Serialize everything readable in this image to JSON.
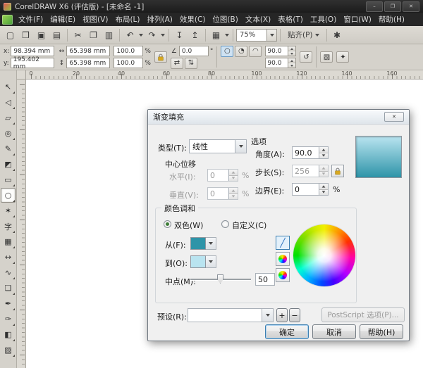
{
  "titlebar": {
    "title": "CorelDRAW X6 (评估版) - [未命名 -1]",
    "minimize_glyph": "–",
    "maximize_glyph": "❐",
    "close_glyph": "✕"
  },
  "menu": {
    "items": [
      "文件(F)",
      "编辑(E)",
      "视图(V)",
      "布局(L)",
      "排列(A)",
      "效果(C)",
      "位图(B)",
      "文本(X)",
      "表格(T)",
      "工具(O)",
      "窗口(W)",
      "帮助(H)"
    ]
  },
  "toolbar": {
    "icons": {
      "new": "▢",
      "open": "❒",
      "save": "▣",
      "print": "▤",
      "cut": "✂",
      "copy": "❐",
      "paste": "▥",
      "undo": "↶",
      "redo": "↷",
      "import": "↧",
      "export": "↥",
      "launcher": "▦",
      "options": "✱"
    },
    "zoom_value": "75%",
    "snap_label": "贴齐(P)"
  },
  "propbar": {
    "x_label": "x:",
    "x_value": "98.394 mm",
    "y_label": "y:",
    "y_value": "195.402 mm",
    "width_icon": "↔",
    "width_value": "65.398 mm",
    "height_icon": "↕",
    "height_value": "65.398 mm",
    "scale_h_value": "100.0",
    "scale_v_value": "100.0",
    "percent": "%",
    "angle_icon": "∠",
    "angle_value": "0.0",
    "degree": "°",
    "mirror_h_icon": "⇄",
    "mirror_v_icon": "⇅",
    "ellipse_icon": "○",
    "pie_icon": "◔",
    "arc_icon": "◠",
    "start_angle_value": "90.0",
    "end_angle_value": "90.0",
    "direction_icon": "↺",
    "wrap_icon": "▧",
    "convert_icon": "✦"
  },
  "ruler": {
    "h_numbers": [
      "0",
      "20",
      "40",
      "60",
      "80",
      "100",
      "120",
      "140",
      "160"
    ]
  },
  "toolbox": {
    "tools": [
      {
        "name": "pick",
        "glyph": "↖"
      },
      {
        "name": "shape",
        "glyph": "◁"
      },
      {
        "name": "crop",
        "glyph": "▱"
      },
      {
        "name": "zoom",
        "glyph": "◎"
      },
      {
        "name": "freehand",
        "glyph": "✎"
      },
      {
        "name": "smart-fill",
        "glyph": "◩"
      },
      {
        "name": "rectangle",
        "glyph": "▭"
      },
      {
        "name": "ellipse",
        "glyph": "○",
        "selected": true
      },
      {
        "name": "polygon",
        "glyph": "✶"
      },
      {
        "name": "text",
        "glyph": "字"
      },
      {
        "name": "table",
        "glyph": "▦"
      },
      {
        "name": "dimension",
        "glyph": "↔"
      },
      {
        "name": "connector",
        "glyph": "∿"
      },
      {
        "name": "blend",
        "glyph": "❏"
      },
      {
        "name": "eyedropper",
        "glyph": "✒"
      },
      {
        "name": "outline-pen",
        "glyph": "✑"
      },
      {
        "name": "fill",
        "glyph": "◧"
      },
      {
        "name": "interactive-fill",
        "glyph": "▨"
      }
    ]
  },
  "dialog": {
    "title": "渐变填充",
    "close_glyph": "✕",
    "type_label": "类型(T):",
    "type_value": "线性",
    "center_group_label": "中心位移",
    "horizontal_label": "水平(I):",
    "horizontal_value": "0",
    "vertical_label": "垂直(V):",
    "vertical_value": "0",
    "percent": "%",
    "options_group_label": "选项",
    "angle_label": "角度(A):",
    "angle_value": "90.0",
    "steps_label": "步长(S):",
    "steps_value": "256",
    "edge_label": "边界(E):",
    "edge_value": "0",
    "blend_group_label": "颜色调和",
    "two_color_label": "双色(W)",
    "custom_label": "自定义(C)",
    "from_label": "从(F):",
    "from_color": "#2e94a8",
    "to_label": "到(O):",
    "to_color": "#b9e4f0",
    "midpoint_label": "中点(M):",
    "midpoint_value": "50",
    "path_direct_glyph": "╱",
    "presets_label": "预设(R):",
    "presets_value": "",
    "plus_label": "+",
    "minus_label": "−",
    "postscript_label": "PostScript 选项(P)...",
    "ok_label": "确定",
    "cancel_label": "取消",
    "help_label": "帮助(H)"
  }
}
